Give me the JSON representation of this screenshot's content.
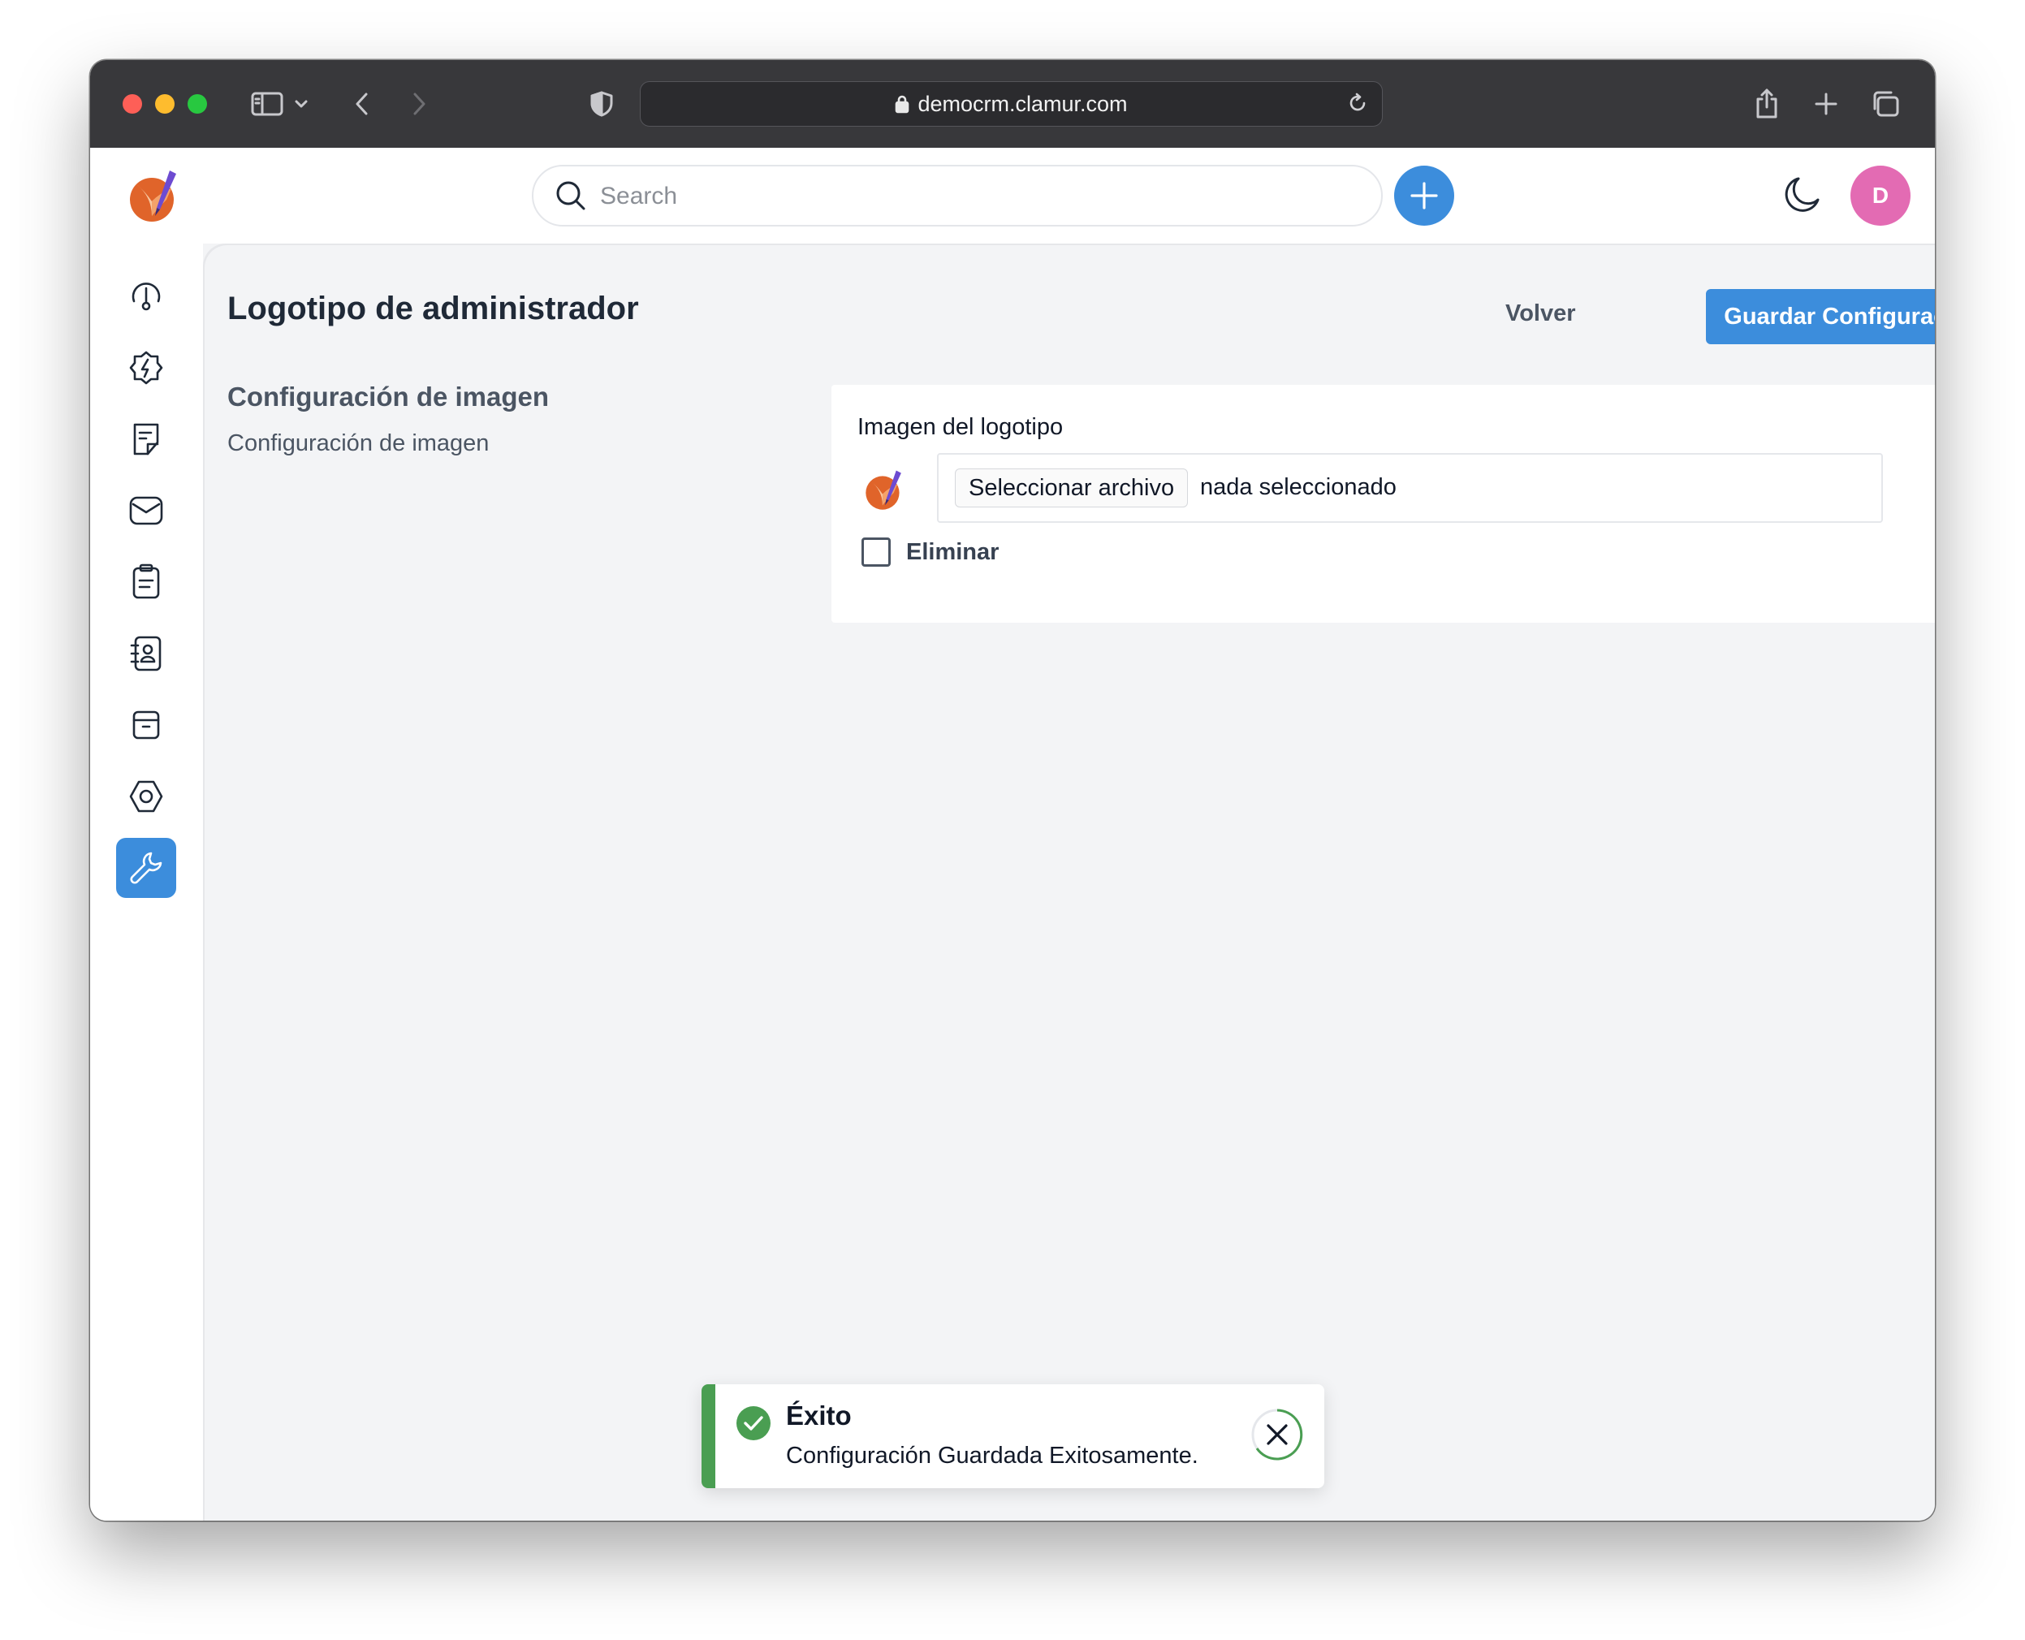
{
  "browser": {
    "url": "democrm.clamur.com",
    "icons": [
      "sidebar-toggle-icon",
      "chevron-down-icon",
      "back-arrow-icon",
      "forward-arrow-icon",
      "shield-icon",
      "lock-icon",
      "reload-icon",
      "share-icon",
      "new-tab-icon",
      "tabs-overview-icon"
    ]
  },
  "header": {
    "search_placeholder": "Search",
    "avatar_initial": "D",
    "colors": {
      "accent": "#3c8ddc",
      "avatar": "#e36bb3"
    }
  },
  "sidebar": {
    "items": [
      {
        "icon": "dashboard-gauge-icon",
        "active": false
      },
      {
        "icon": "activity-bolt-icon",
        "active": false
      },
      {
        "icon": "sticky-note-icon",
        "active": false
      },
      {
        "icon": "mail-icon",
        "active": false
      },
      {
        "icon": "clipboard-icon",
        "active": false
      },
      {
        "icon": "contacts-book-icon",
        "active": false
      },
      {
        "icon": "archive-box-icon",
        "active": false
      },
      {
        "icon": "settings-hexagon-icon",
        "active": false
      },
      {
        "icon": "wrench-icon",
        "active": true
      }
    ]
  },
  "page": {
    "title": "Logotipo de administrador",
    "back_label": "Volver",
    "save_label": "Guardar Configuración"
  },
  "section": {
    "title": "Configuración de imagen",
    "subtitle": "Configuración de imagen"
  },
  "form": {
    "logo_label": "Imagen del logotipo",
    "file_button": "Seleccionar archivo",
    "file_status": "nada seleccionado",
    "delete_label": "Eliminar",
    "delete_checked": false
  },
  "toast": {
    "title": "Éxito",
    "message": "Configuración Guardada Exitosamente.",
    "color": "#4a9e52"
  }
}
